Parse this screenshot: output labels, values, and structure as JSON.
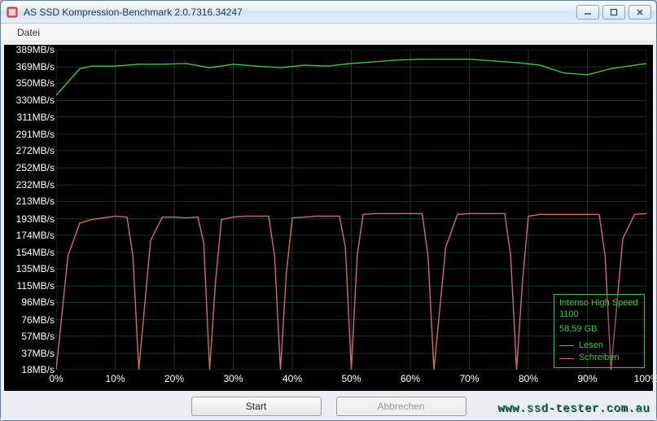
{
  "window": {
    "title": "AS SSD Kompression-Benchmark 2.0.7316.34247"
  },
  "menu": {
    "file": "Datei"
  },
  "legend": {
    "device": "Intenso High Speed 1100",
    "size": "58,59 GB",
    "read": "Lesen",
    "write": "Schreiben"
  },
  "buttons": {
    "start": "Start",
    "cancel": "Abbrechen"
  },
  "watermark": "www.ssd-tester.com.au",
  "chart_data": {
    "type": "line",
    "title": "",
    "xlabel": "",
    "ylabel": "",
    "x_unit": "%",
    "y_unit": "MB/s",
    "xlim": [
      0,
      100
    ],
    "ylim": [
      18,
      389
    ],
    "x_ticks": [
      0,
      10,
      20,
      30,
      40,
      50,
      60,
      70,
      80,
      90,
      100
    ],
    "y_ticks": [
      389,
      369,
      350,
      330,
      311,
      291,
      272,
      252,
      232,
      213,
      193,
      174,
      154,
      135,
      115,
      96,
      76,
      57,
      37,
      18
    ],
    "colors": {
      "Lesen": "#3fc63f",
      "Schreiben": "#d46a6a"
    },
    "series": [
      {
        "name": "Lesen",
        "x": [
          0,
          4,
          6,
          10,
          14,
          18,
          22,
          26,
          30,
          34,
          38,
          42,
          46,
          50,
          54,
          58,
          62,
          66,
          70,
          74,
          78,
          82,
          86,
          90,
          94,
          98,
          100
        ],
        "values": [
          336,
          367,
          370,
          370,
          372,
          372,
          373,
          368,
          372,
          370,
          368,
          371,
          370,
          373,
          375,
          377,
          378,
          378,
          378,
          376,
          374,
          371,
          362,
          360,
          367,
          371,
          373
        ]
      },
      {
        "name": "Schreiben",
        "x": [
          0,
          2,
          4,
          6,
          8,
          10,
          12,
          13,
          14,
          16,
          18,
          20,
          22,
          24,
          25,
          26,
          27,
          28,
          30,
          32,
          34,
          36,
          37,
          38,
          39,
          40,
          42,
          44,
          46,
          48,
          49,
          50,
          51,
          52,
          54,
          56,
          58,
          60,
          62,
          63,
          64,
          66,
          68,
          70,
          72,
          74,
          76,
          77,
          78,
          79,
          80,
          82,
          84,
          86,
          88,
          90,
          92,
          93,
          94,
          96,
          98,
          100
        ],
        "values": [
          18,
          150,
          188,
          192,
          194,
          196,
          195,
          150,
          18,
          168,
          195,
          195,
          194,
          195,
          165,
          18,
          120,
          192,
          195,
          196,
          196,
          196,
          150,
          18,
          130,
          194,
          195,
          196,
          196,
          196,
          160,
          18,
          150,
          198,
          199,
          199,
          199,
          199,
          199,
          150,
          18,
          160,
          198,
          199,
          199,
          199,
          199,
          150,
          18,
          120,
          196,
          198,
          198,
          198,
          198,
          198,
          198,
          150,
          18,
          170,
          198,
          199
        ]
      }
    ]
  }
}
